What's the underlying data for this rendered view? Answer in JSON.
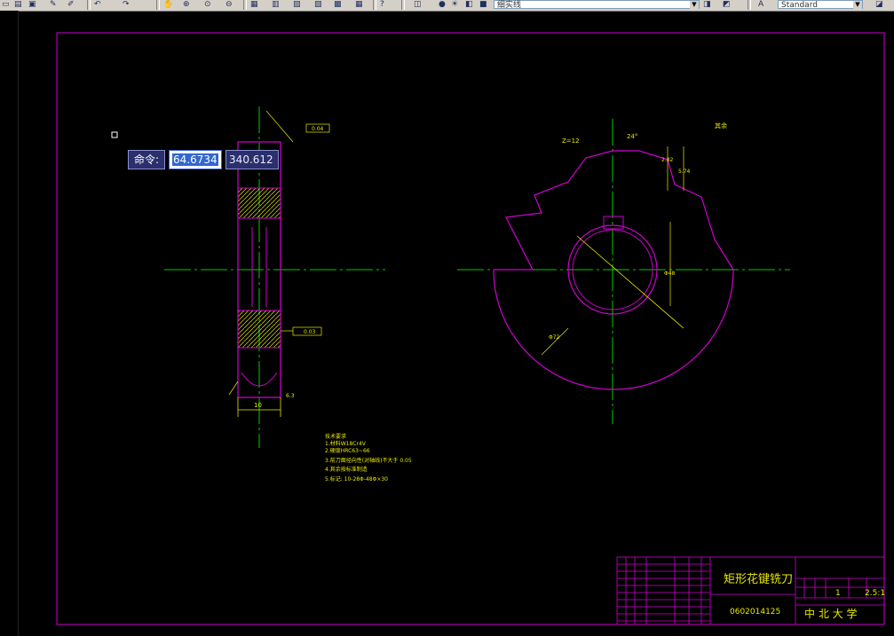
{
  "toolbar": {
    "linetype_combo": "细实线",
    "textstyle_combo": "Standard"
  },
  "command_tooltip": {
    "label": "命令:",
    "x_value": "64.6734",
    "y_value": "340.612"
  },
  "drawing": {
    "title": "矩形花键铣刀",
    "drawing_number": "0602014125",
    "school": "中 北 大 学",
    "scale": "2.5:1",
    "count": "1",
    "tech_notes": [
      "技术要求",
      "1.材料W18Cr4V",
      "2.硬度HRC63~66",
      "3.前刀面径向性(对轴线)不大于 0.05",
      "4.其余按标准制造",
      "5.标记: 10-28Φ-48Φ×30"
    ],
    "gear_annotations": {
      "teeth": "Z=12",
      "dim_1": "2.82",
      "dim_2": "5.74",
      "dim_3": "Φ48",
      "dim_4": "Φ72",
      "angle": "24°"
    },
    "section_annotations": {
      "dim_top": "0.04",
      "dim_bottom": "0.03",
      "width": "10",
      "surface": "6.3"
    },
    "roughness_note": "其余"
  },
  "colors": {
    "frame": "#d000d0",
    "geometry": "#d000d0",
    "dimension": "#e8e800",
    "center": "#00cc00",
    "hatch": "#e8e800",
    "text": "#e8e800"
  }
}
